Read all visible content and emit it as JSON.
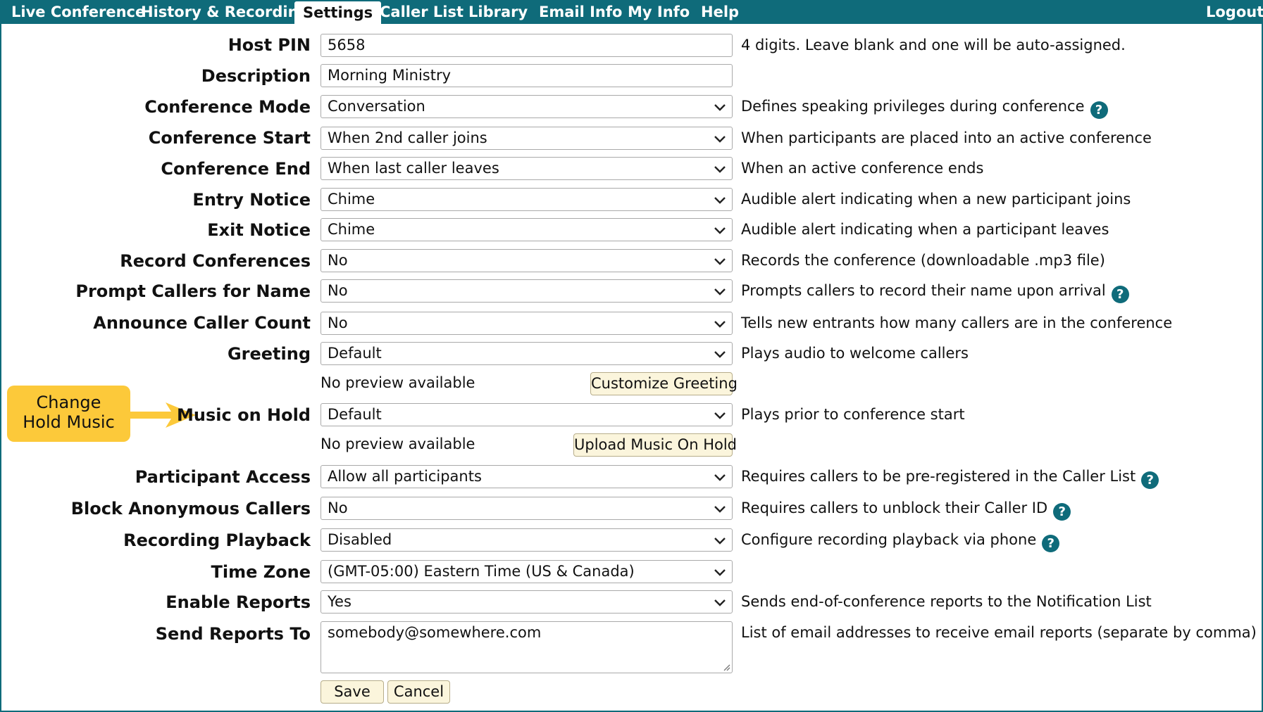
{
  "nav": {
    "tabs": [
      "Live Conference",
      "History & Recordings",
      "Settings",
      "Caller List",
      "Library",
      "Email Info",
      "My Info",
      "Help"
    ],
    "active_tab": "Settings",
    "logout": "Logout"
  },
  "rows": {
    "host_pin": {
      "label": "Host PIN",
      "value": "5658",
      "desc": "4 digits. Leave blank and one will be auto-assigned."
    },
    "description": {
      "label": "Description",
      "value": "Morning Ministry"
    },
    "conference_mode": {
      "label": "Conference Mode",
      "value": "Conversation",
      "desc": "Defines speaking privileges during conference"
    },
    "conference_start": {
      "label": "Conference Start",
      "value": "When 2nd caller joins",
      "desc": "When participants are placed into an active conference"
    },
    "conference_end": {
      "label": "Conference End",
      "value": "When last caller leaves",
      "desc": "When an active conference ends"
    },
    "entry_notice": {
      "label": "Entry Notice",
      "value": "Chime",
      "desc": "Audible alert indicating when a new participant joins"
    },
    "exit_notice": {
      "label": "Exit Notice",
      "value": "Chime",
      "desc": "Audible alert indicating when a participant leaves"
    },
    "record_conferences": {
      "label": "Record Conferences",
      "value": "No",
      "desc": "Records the conference (downloadable .mp3 file)"
    },
    "prompt_callers": {
      "label": "Prompt Callers for Name",
      "value": "No",
      "desc": "Prompts callers to record their name upon arrival"
    },
    "announce_count": {
      "label": "Announce Caller Count",
      "value": "No",
      "desc": "Tells new entrants how many callers are in the conference"
    },
    "greeting": {
      "label": "Greeting",
      "value": "Default",
      "desc": "Plays audio to welcome callers",
      "preview": "No preview available",
      "button": "Customize Greeting"
    },
    "music_on_hold": {
      "label": "Music on Hold",
      "value": "Default",
      "desc": "Plays prior to conference start",
      "preview": "No preview available",
      "button": "Upload Music On Hold"
    },
    "participant_access": {
      "label": "Participant Access",
      "value": "Allow all participants",
      "desc": "Requires callers to be pre-registered in the Caller List"
    },
    "block_anonymous": {
      "label": "Block Anonymous Callers",
      "value": "No",
      "desc": "Requires callers to unblock their Caller ID"
    },
    "recording_playback": {
      "label": "Recording Playback",
      "value": "Disabled",
      "desc": "Configure recording playback via phone"
    },
    "time_zone": {
      "label": "Time Zone",
      "value": "(GMT-05:00) Eastern Time (US & Canada)"
    },
    "enable_reports": {
      "label": "Enable Reports",
      "value": "Yes",
      "desc": "Sends end-of-conference reports to the Notification List"
    },
    "send_reports_to": {
      "label": "Send Reports To",
      "value": "somebody@somewhere.com",
      "desc": "List of email addresses to receive email reports (separate by comma)"
    }
  },
  "help_glyph": "?",
  "actions": {
    "save": "Save",
    "cancel": "Cancel"
  },
  "callout": {
    "line1": "Change",
    "line2": "Hold Music"
  },
  "colors": {
    "nav": "#0f6b7a",
    "help": "#0f6b7a",
    "callout": "#fcc93a",
    "button_bg": "#fbf5dc"
  },
  "icons": {
    "select": "chevron-down-icon",
    "help": "help-icon",
    "callout_arrow": "arrow-right-icon"
  }
}
